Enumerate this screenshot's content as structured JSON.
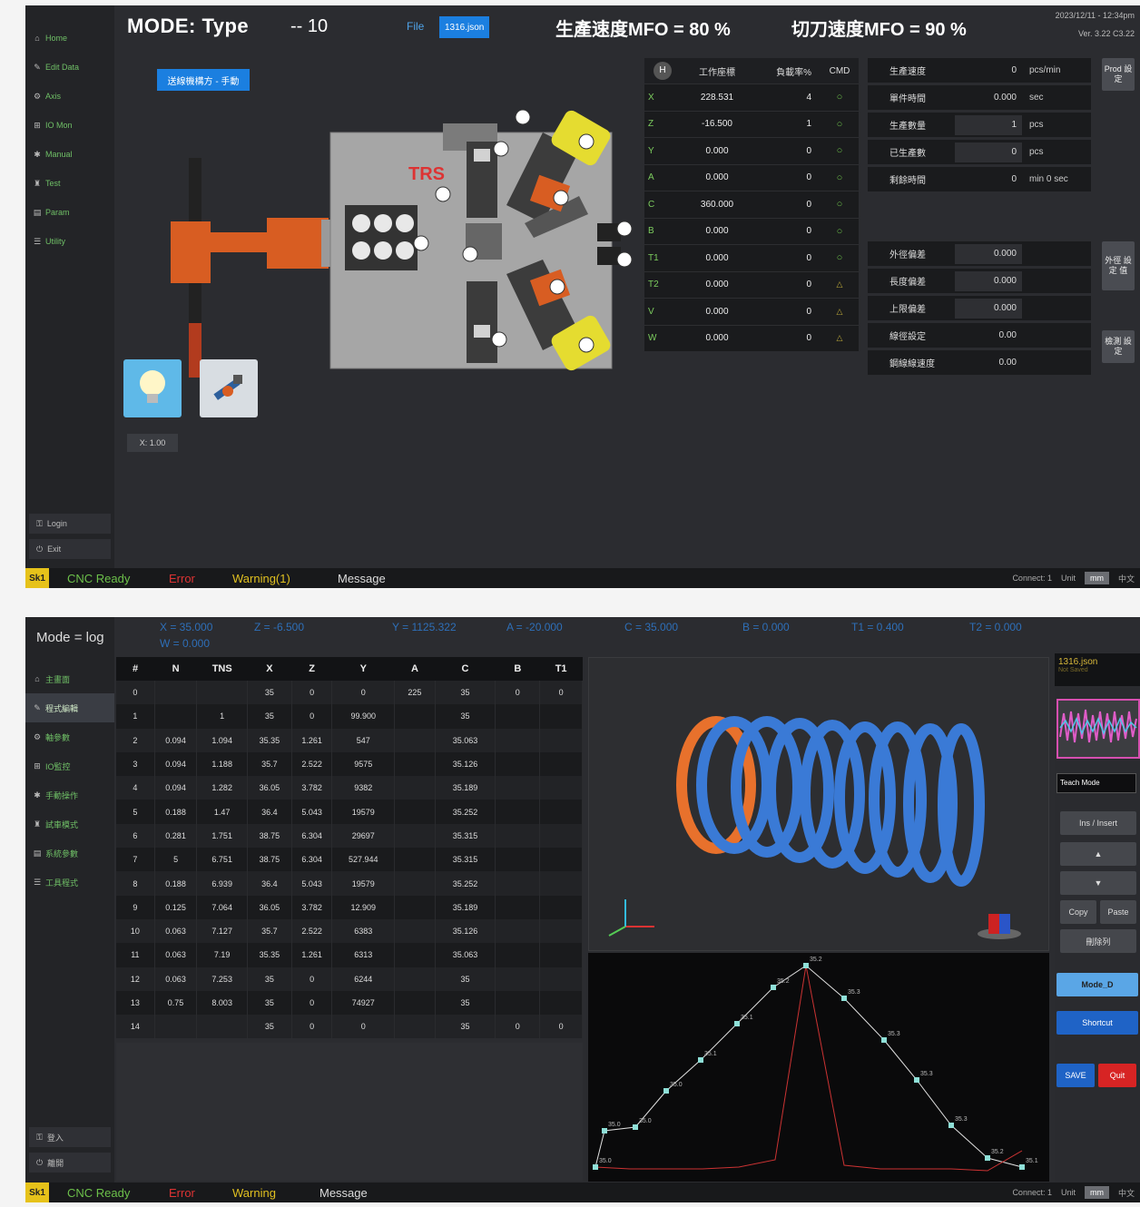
{
  "screen1": {
    "sidebar": [
      {
        "icon": "⌂",
        "label": "Home"
      },
      {
        "icon": "✎",
        "label": "Edit Data"
      },
      {
        "icon": "⚙",
        "label": "Axis"
      },
      {
        "icon": "⊞",
        "label": "IO Mon"
      },
      {
        "icon": "✱",
        "label": "Manual"
      },
      {
        "icon": "♜",
        "label": "Test"
      },
      {
        "icon": "▤",
        "label": "Param"
      },
      {
        "icon": "☰",
        "label": "Utility"
      }
    ],
    "sidebar_bottom": [
      "Login",
      "Exit"
    ],
    "mode_title": "MODE: Type",
    "mode_num": "-- 10",
    "file_label": "File",
    "file_chip": "1316.json",
    "mfo1": "生產速度MFO = 80 %",
    "mfo2": "切刀速度MFO = 90 %",
    "version1": "2023/12/11 - 12:34pm",
    "version2": "Ver. 3.22  C3.22",
    "blue_chip": "送線機構方 - 手動",
    "logo": "TRS",
    "small_chip": "X: 1.00",
    "axis_header": {
      "h": "H",
      "c1": "工作座標",
      "c2": "負載率%",
      "c3": "CMD"
    },
    "axes": [
      {
        "n": "X",
        "pos": "228.531",
        "load": "4",
        "st": "g"
      },
      {
        "n": "Z",
        "pos": "-16.500",
        "load": "1",
        "st": "g"
      },
      {
        "n": "Y",
        "pos": "0.000",
        "load": "0",
        "st": "g"
      },
      {
        "n": "A",
        "pos": "0.000",
        "load": "0",
        "st": "g"
      },
      {
        "n": "C",
        "pos": "360.000",
        "load": "0",
        "st": "g"
      },
      {
        "n": "B",
        "pos": "0.000",
        "load": "0",
        "st": "g"
      },
      {
        "n": "T1",
        "pos": "0.000",
        "load": "0",
        "st": "g"
      },
      {
        "n": "T2",
        "pos": "0.000",
        "load": "0",
        "st": "y"
      },
      {
        "n": "V",
        "pos": "0.000",
        "load": "0",
        "st": "y"
      },
      {
        "n": "W",
        "pos": "0.000",
        "load": "0",
        "st": "y"
      }
    ],
    "params1": [
      {
        "label": "生產速度",
        "val": "0",
        "unit": "pcs/min",
        "boxed": false
      },
      {
        "label": "單件時間",
        "val": "0.000",
        "unit": "sec",
        "boxed": false
      },
      {
        "label": "生產數量",
        "val": "1",
        "unit": "pcs",
        "boxed": true
      },
      {
        "label": "已生產數",
        "val": "0",
        "unit": "pcs",
        "boxed": true
      },
      {
        "label": "剩餘時間",
        "val": "0",
        "unit": "min   0  sec",
        "boxed": false
      }
    ],
    "params2": [
      {
        "label": "外徑偏差",
        "val": "0.000",
        "boxed": true
      },
      {
        "label": "長度偏差",
        "val": "0.000",
        "boxed": true
      },
      {
        "label": "上限偏差",
        "val": "0.000",
        "boxed": true
      },
      {
        "label": "線徑設定",
        "val": "0.00",
        "boxed": false
      },
      {
        "label": "鋼線線速度",
        "val": "0.00",
        "boxed": false
      }
    ],
    "side_btn1": "Prod 設定",
    "side_btn2": "外徑 設定 值",
    "side_btn3": "檢測 設定",
    "status": {
      "badge": "Sk1",
      "ready": "CNC Ready",
      "error": "Error",
      "warning": "Warning(1)",
      "message": "Message",
      "conn": "Connect: 1",
      "unit": "Unit",
      "btn": "mm",
      "lang": "中文"
    }
  },
  "screen2": {
    "sidebar": [
      {
        "icon": "⌂",
        "label": "主畫面"
      },
      {
        "icon": "✎",
        "label": "程式編輯"
      },
      {
        "icon": "⚙",
        "label": "軸參數"
      },
      {
        "icon": "⊞",
        "label": "IO監控"
      },
      {
        "icon": "✱",
        "label": "手動操作"
      },
      {
        "icon": "♜",
        "label": "試車模式"
      },
      {
        "icon": "▤",
        "label": "系統參數"
      },
      {
        "icon": "☰",
        "label": "工具程式"
      }
    ],
    "sidebar_bottom": [
      "登入",
      "離開"
    ],
    "mode": "Mode = log",
    "coords": [
      "X = 35.000",
      "Z = -6.500",
      "Y = 1125.322",
      "A = -20.000",
      "C = 35.000",
      "B = 0.000",
      "T1 = 0.400",
      "T2 = 0.000"
    ],
    "coords2": "W = 0.000",
    "cols": [
      "#",
      "N",
      "TNS",
      "X",
      "Z",
      "Y",
      "A",
      "C",
      "B",
      "T1"
    ],
    "rows": [
      [
        "0",
        "",
        "",
        "35",
        "0",
        "0",
        "225",
        "35",
        "0",
        "0"
      ],
      [
        "1",
        "",
        "1",
        "35",
        "0",
        "99.900",
        "",
        "35",
        "",
        ""
      ],
      [
        "2",
        "0.094",
        "1.094",
        "35.35",
        "1.261",
        "547",
        "",
        "35.063",
        "",
        ""
      ],
      [
        "3",
        "0.094",
        "1.188",
        "35.7",
        "2.522",
        "9575",
        "",
        "35.126",
        "",
        ""
      ],
      [
        "4",
        "0.094",
        "1.282",
        "36.05",
        "3.782",
        "9382",
        "",
        "35.189",
        "",
        ""
      ],
      [
        "5",
        "0.188",
        "1.47",
        "36.4",
        "5.043",
        "19579",
        "",
        "35.252",
        "",
        ""
      ],
      [
        "6",
        "0.281",
        "1.751",
        "38.75",
        "6.304",
        "29697",
        "",
        "35.315",
        "",
        ""
      ],
      [
        "7",
        "5",
        "6.751",
        "38.75",
        "6.304",
        "527.944",
        "",
        "35.315",
        "",
        ""
      ],
      [
        "8",
        "0.188",
        "6.939",
        "36.4",
        "5.043",
        "19579",
        "",
        "35.252",
        "",
        ""
      ],
      [
        "9",
        "0.125",
        "7.064",
        "36.05",
        "3.782",
        "12.909",
        "",
        "35.189",
        "",
        ""
      ],
      [
        "10",
        "0.063",
        "7.127",
        "35.7",
        "2.522",
        "6383",
        "",
        "35.126",
        "",
        ""
      ],
      [
        "11",
        "0.063",
        "7.19",
        "35.35",
        "1.261",
        "6313",
        "",
        "35.063",
        "",
        ""
      ],
      [
        "12",
        "0.063",
        "7.253",
        "35",
        "0",
        "6244",
        "",
        "35",
        "",
        ""
      ],
      [
        "13",
        "0.75",
        "8.003",
        "35",
        "0",
        "74927",
        "",
        "35",
        "",
        ""
      ],
      [
        "14",
        "",
        "",
        "35",
        "0",
        "0",
        "",
        "35",
        "0",
        "0"
      ]
    ],
    "file_name": "1316.json",
    "file_sub": "Not Saved",
    "teach": "Teach Mode",
    "btn_insert": "Ins / Insert",
    "btn_up": "▲",
    "btn_down": "▼",
    "btn_copy": "Copy",
    "btn_paste": "Paste",
    "btn_delete": "刪除列",
    "btn_mode": "Mode_D",
    "btn_shortcut": "Shortcut",
    "btn_save": "SAVE",
    "btn_quit": "Quit",
    "graph_labels": [
      "35.0",
      "35.0",
      "35.0",
      "35.0",
      "35.1",
      "35.1",
      "35.2",
      "35.2",
      "35.3",
      "35.3",
      "35.3",
      "35.3",
      "35.2",
      "35.1",
      "35.1",
      "35.0"
    ],
    "status": {
      "badge": "Sk1",
      "ready": "CNC Ready",
      "error": "Error",
      "warning": "Warning",
      "message": "Message",
      "conn": "Connect: 1",
      "unit": "Unit",
      "btn": "mm",
      "lang": "中文"
    }
  }
}
